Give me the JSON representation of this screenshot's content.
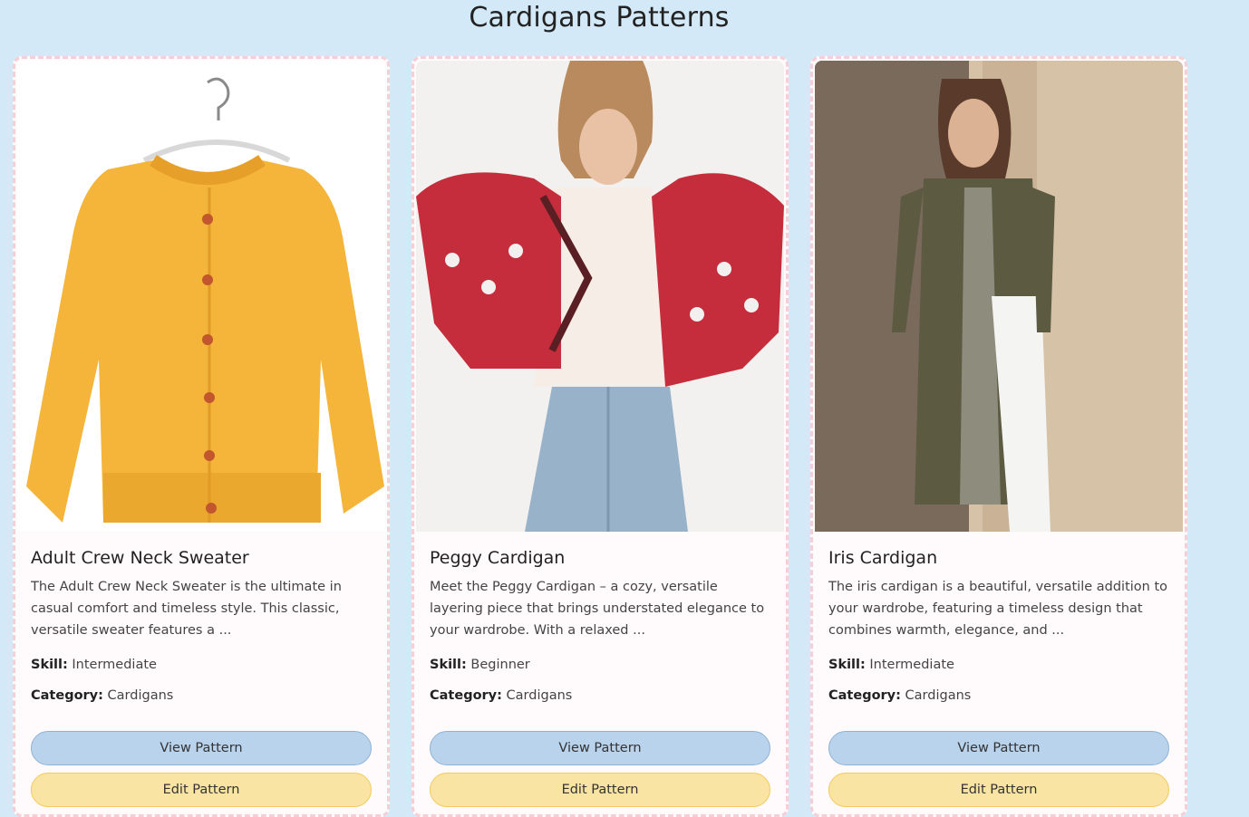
{
  "page": {
    "title": "Cardigans Patterns"
  },
  "labels": {
    "skill": "Skill:",
    "category": "Category:"
  },
  "cards": [
    {
      "title": "Adult Crew Neck Sweater",
      "description": "The Adult Crew Neck Sweater is the ultimate in casual comfort and timeless style. This classic, versatile sweater features a ...",
      "skill": "Intermediate",
      "category": "Cardigans",
      "view_label": "View Pattern",
      "edit_label": "Edit Pattern",
      "image": "yellow crochet cardigan on hanger"
    },
    {
      "title": "Peggy Cardigan",
      "description": "Meet the Peggy Cardigan – a cozy, versatile layering piece that brings understated elegance to your wardrobe. With a relaxed ...",
      "skill": "Beginner",
      "category": "Cardigans",
      "view_label": "View Pattern",
      "edit_label": "Edit Pattern",
      "image": "woman wearing red crochet cardigan"
    },
    {
      "title": "Iris Cardigan",
      "description": "The iris cardigan is a beautiful, versatile addition to your wardrobe, featuring a timeless design that combines warmth, elegance, and ...",
      "skill": "Intermediate",
      "category": "Cardigans",
      "view_label": "View Pattern",
      "edit_label": "Edit Pattern",
      "image": "woman in long olive lace cardigan by brick wall"
    }
  ],
  "colors": {
    "background": "#d3e9f7",
    "card_border": "#f6cfd6",
    "view_button": "#b9d3ed",
    "edit_button": "#f9e4a3"
  }
}
